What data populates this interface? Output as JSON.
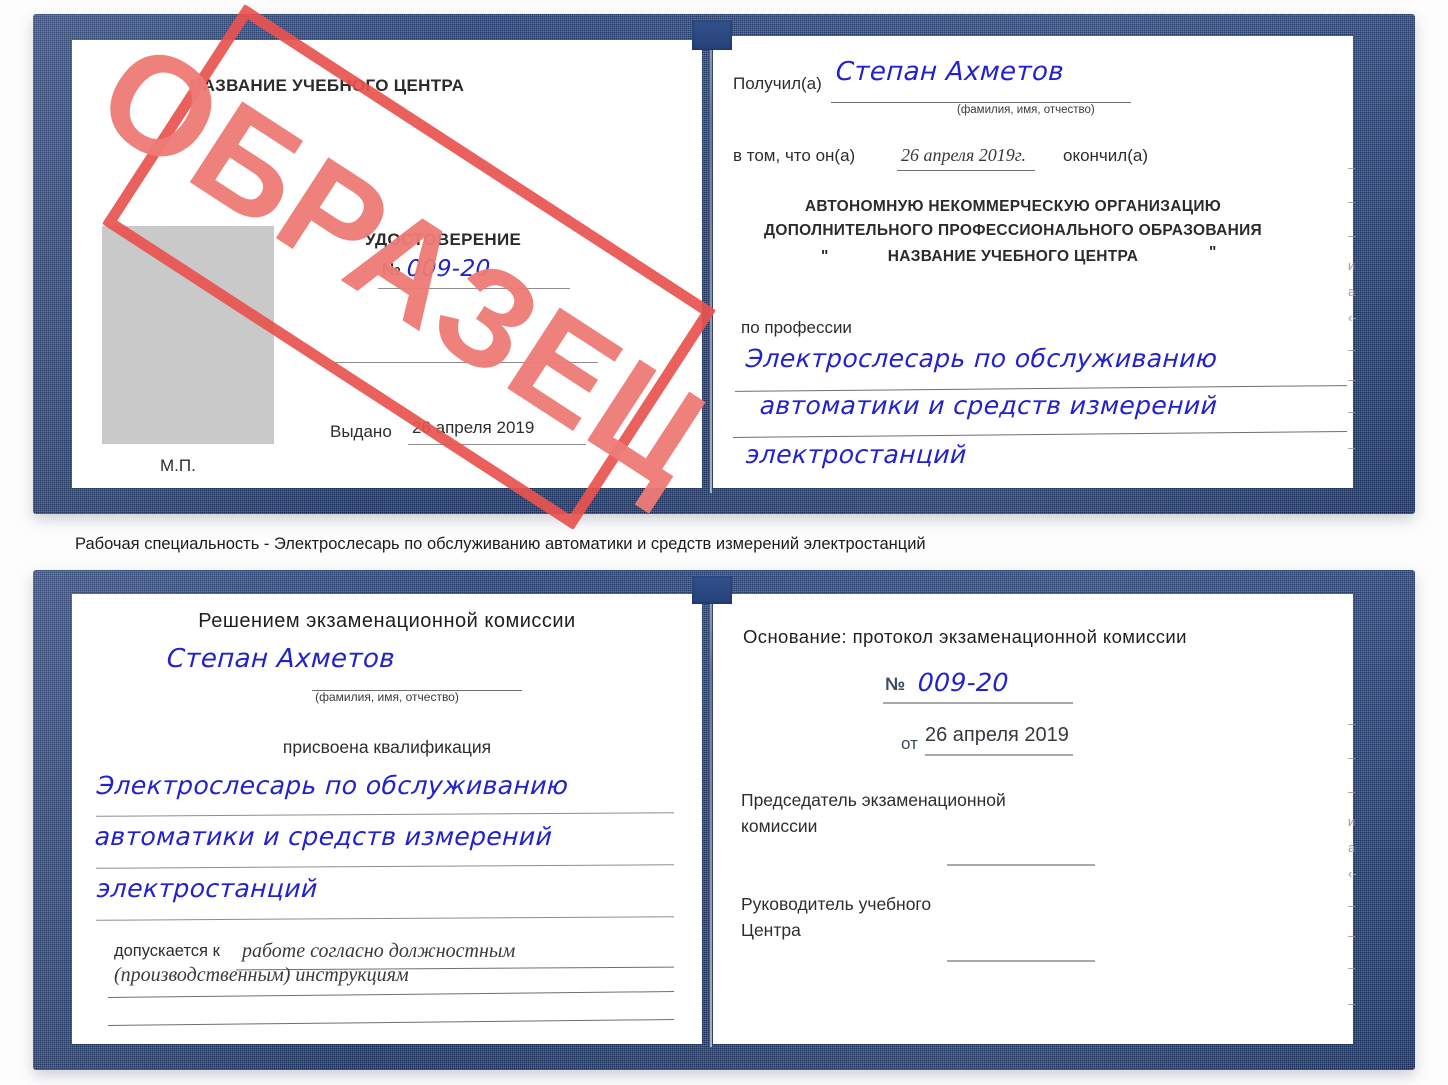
{
  "caption": {
    "text": "Рабочая специальность - Электрослесарь по обслуживанию автоматики и средств измерений электростанций"
  },
  "stamp": {
    "label": "ОБРАЗЕЦ",
    "border_color": "#e8534f",
    "text_color": "#ef7b77"
  },
  "colors": {
    "cover": "#24417a",
    "handwriting": "#2222cc",
    "page": "#ffffff",
    "photo_placeholder": "#c9c9c9",
    "rule": "#8d8d8d"
  },
  "certificate_top": {
    "left_page": {
      "center_name": "НАЗВАНИЕ УЧЕБНОГО ЦЕНТРА",
      "doc_type": "УДОСТОВЕРЕНИЕ",
      "number_label": "№",
      "number_value": "009-20",
      "issued_label": "Выдано",
      "issued_value": "26 апреля 2019",
      "seal_label": "М.П."
    },
    "right_page": {
      "received_label": "Получил(а)",
      "received_value": "Степан Ахметов",
      "fio_hint": "(фамилия, имя, отчество)",
      "that_he_label": "в том, что он(а)",
      "that_he_value": "26 апреля 2019г.",
      "finished_label": "окончил(а)",
      "org_line1": "АВТОНОМНУЮ НЕКОММЕРЧЕСКУЮ ОРГАНИЗАЦИЮ",
      "org_line2": "ДОПОЛНИТЕЛЬНОГО ПРОФЕССИОНАЛЬНОГО ОБРАЗОВАНИЯ",
      "org_quote_open": "\"",
      "org_line3": "НАЗВАНИЕ УЧЕБНОГО ЦЕНТРА",
      "org_quote_close": "\"",
      "profession_label": "по профессии",
      "profession_line1": "Электрослесарь по обслуживанию",
      "profession_line2": "автоматики и средств измерений",
      "profession_line3": "электростанций",
      "bleed_marks": [
        "–",
        "–",
        "–",
        "и",
        "а",
        "‹-",
        "–",
        "–",
        "–",
        "–"
      ]
    }
  },
  "certificate_bottom": {
    "left_page": {
      "heading": "Решением экзаменационной комиссии",
      "name_value": "Степан Ахметов",
      "fio_hint": "(фамилия, имя, отчество)",
      "qualification_label": "присвоена квалификация",
      "qualification_line1": "Электрослесарь по обслуживанию",
      "qualification_line2": "автоматики и средств измерений",
      "qualification_line3": "электростанций",
      "allowed_label": "допускается к",
      "allowed_value_line1": "работе согласно должностным",
      "allowed_value_line2": "(производственным) инструкциям"
    },
    "right_page": {
      "basis_label": "Основание: протокол экзаменационной комиссии",
      "number_label": "№",
      "number_value": "009-20",
      "date_label": "от",
      "date_value": "26 апреля 2019",
      "chairman_line1": "Председатель экзаменационной",
      "chairman_line2": "комиссии",
      "head_line1": "Руководитель учебного",
      "head_line2": "Центра",
      "bleed_marks": [
        "–",
        "–",
        "–",
        "и",
        "а",
        "‹-",
        "–",
        "–",
        "–",
        "–"
      ]
    }
  }
}
